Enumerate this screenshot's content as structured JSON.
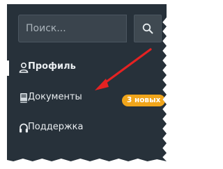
{
  "search": {
    "placeholder": "Поиск...",
    "button_icon": "search-icon"
  },
  "nav": {
    "items": [
      {
        "label": "Профиль",
        "icon": "user-icon",
        "active": true
      },
      {
        "label": "Документы",
        "icon": "book-icon",
        "active": false
      },
      {
        "label": "Поддержка",
        "icon": "headphones-icon",
        "active": false
      }
    ],
    "badge": "3 новых"
  },
  "annotation": {
    "icon": "red-arrow-icon",
    "color": "#e52222"
  },
  "colors": {
    "panel": "#27313a",
    "badge": "#f0a51b",
    "text": "#e9edf0"
  }
}
